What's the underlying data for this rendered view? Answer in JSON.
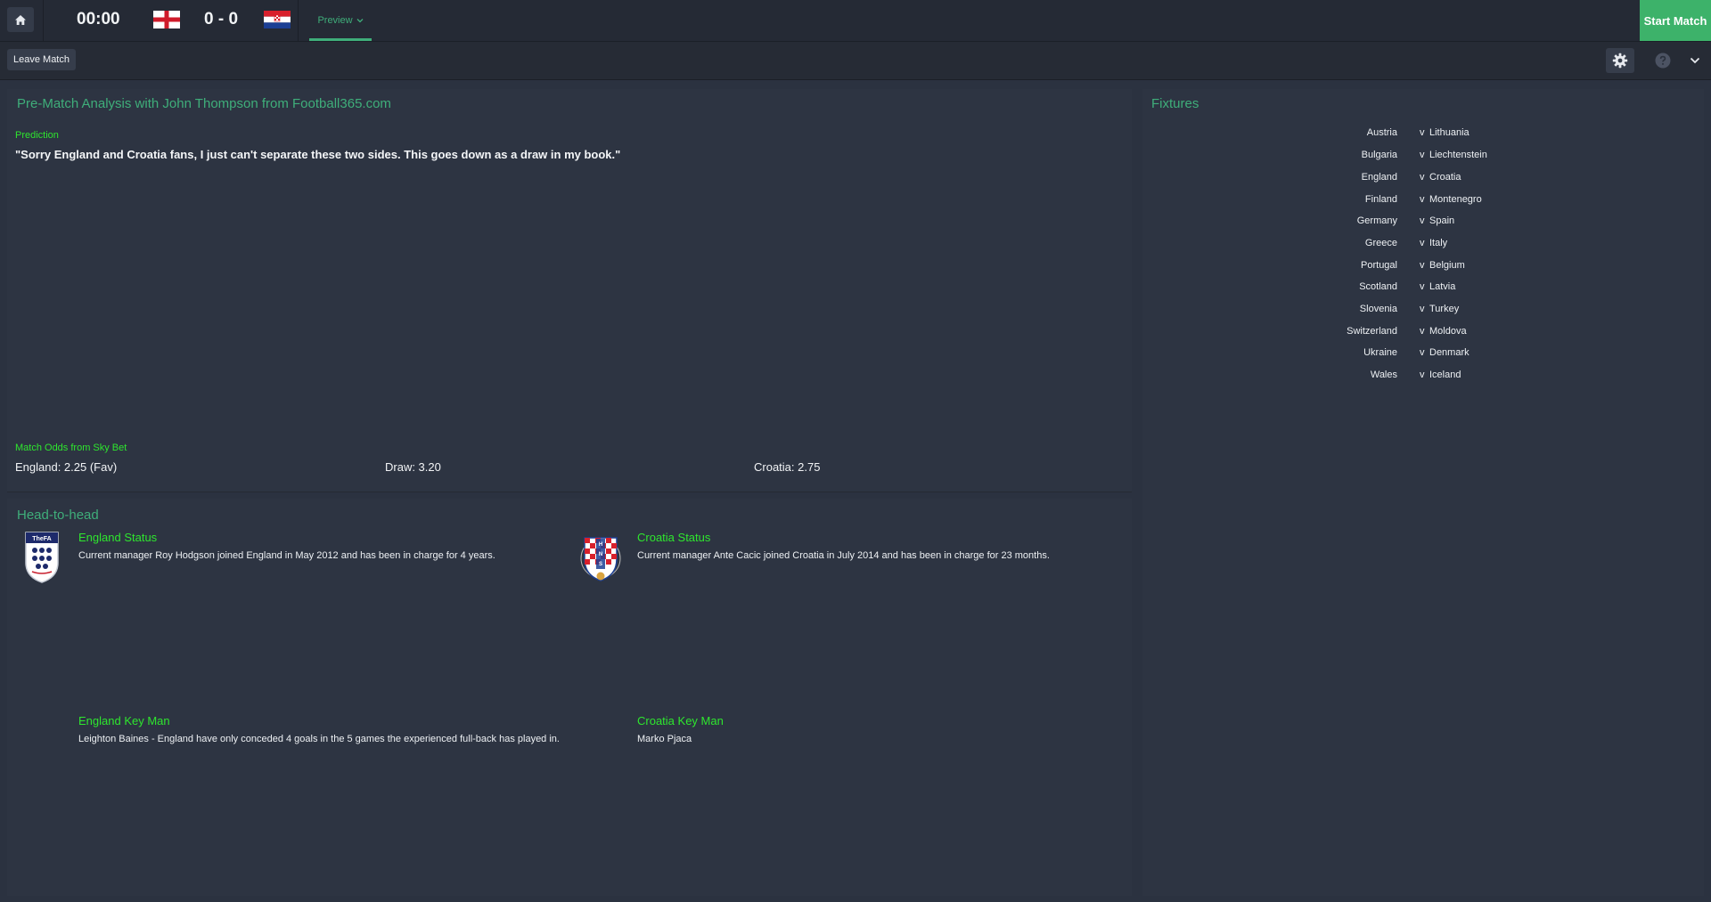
{
  "topbar": {
    "clock": "00:00",
    "score": "0 - 0",
    "preview_tab": "Preview",
    "start_match": "Start Match"
  },
  "subbar": {
    "leave_match": "Leave Match"
  },
  "analysis": {
    "title": "Pre-Match Analysis with John Thompson from Football365.com",
    "prediction_label": "Prediction",
    "prediction_quote": "\"Sorry England and Croatia fans, I just can't separate these two sides. This goes down as a draw in my book.\"",
    "odds_label": "Match Odds from Sky Bet",
    "odds_home": "England: 2.25 (Fav)",
    "odds_draw": "Draw: 3.20",
    "odds_away": "Croatia: 2.75"
  },
  "head_to_head": {
    "title": "Head-to-head",
    "home_crest_text": "TheFA",
    "home_status_title": "England Status",
    "home_status_text": "Current manager Roy Hodgson joined England in May 2012 and has been in charge for 4 years.",
    "away_crest_text": "HNS",
    "away_status_title": "Croatia Status",
    "away_status_text": "Current manager Ante Cacic joined Croatia in July 2014 and has been in charge for 23 months.",
    "home_keyman_title": "England Key Man",
    "home_keyman_text": "Leighton Baines - England have only conceded 4 goals in the 5 games the experienced full-back has played in.",
    "away_keyman_title": "Croatia Key Man",
    "away_keyman_text": "Marko Pjaca"
  },
  "fixtures": {
    "title": "Fixtures",
    "separator": "v",
    "rows": [
      {
        "home": "Austria",
        "away": "Lithuania"
      },
      {
        "home": "Bulgaria",
        "away": "Liechtenstein"
      },
      {
        "home": "England",
        "away": "Croatia"
      },
      {
        "home": "Finland",
        "away": "Montenegro"
      },
      {
        "home": "Germany",
        "away": "Spain"
      },
      {
        "home": "Greece",
        "away": "Italy"
      },
      {
        "home": "Portugal",
        "away": "Belgium"
      },
      {
        "home": "Scotland",
        "away": "Latvia"
      },
      {
        "home": "Slovenia",
        "away": "Turkey"
      },
      {
        "home": "Switzerland",
        "away": "Moldova"
      },
      {
        "home": "Ukraine",
        "away": "Denmark"
      },
      {
        "home": "Wales",
        "away": "Iceland"
      }
    ]
  },
  "colors": {
    "accent_green": "#3fae7a",
    "label_green": "#2ee62e",
    "start_button": "#3db26a"
  }
}
